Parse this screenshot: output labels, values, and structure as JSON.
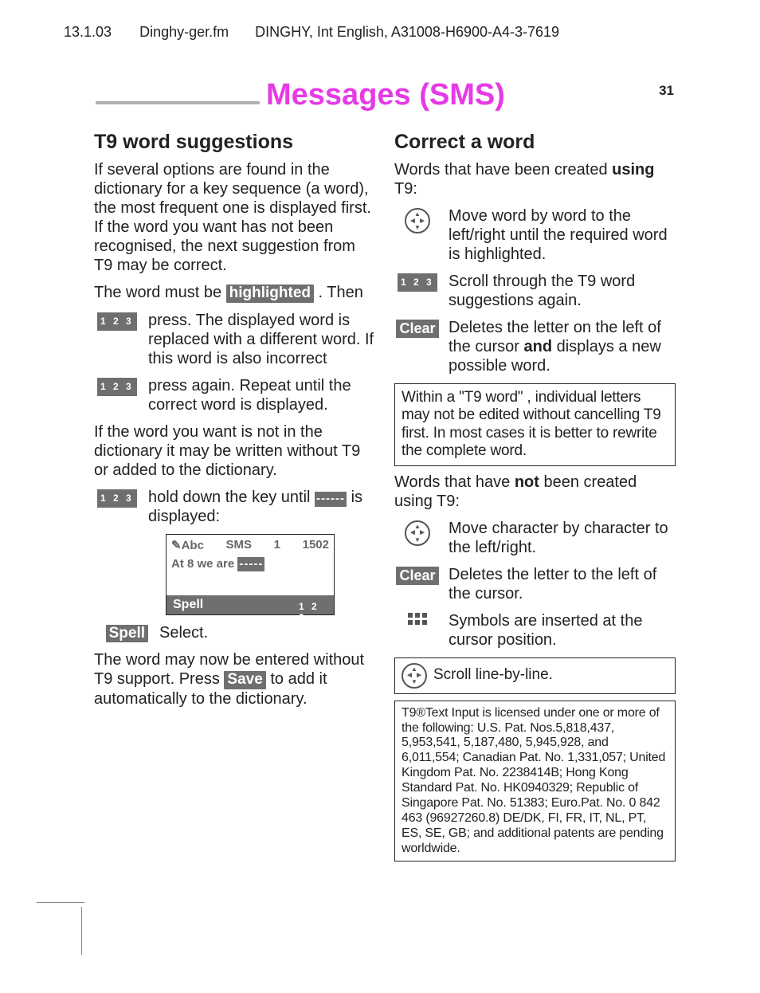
{
  "header": {
    "date": "13.1.03",
    "file": "Dinghy-ger.fm",
    "doc": "DINGHY, Int English, A31008-H6900-A4-3-7619"
  },
  "title": "Messages (SMS)",
  "page_number": "31",
  "left": {
    "heading": "T9 word suggestions",
    "p1": "If several options are found in the dictionary for a key sequence (a word), the most frequent one is displayed first. If the word you want has not been recognised, the next suggestion from T9 may be correct.",
    "p2_pre": "The word must be ",
    "p2_chip": "highlighted",
    "p2_post": " . Then",
    "step1": "press. The displayed word is replaced with a different word. If this word is also incorrect",
    "step2": "press again. Repeat until the correct word is displayed.",
    "p3": "If the word you want is not in the dictionary it may be written without T9 or added to the dictionary.",
    "step3_pre": "hold down the key until ",
    "step3_post": " is displayed:",
    "dash_chip": "------",
    "phone": {
      "mode": "Abc",
      "title": "SMS",
      "count": "1",
      "max": "1502",
      "body_pre": "At 8 we are ",
      "body_chip": "-----",
      "softkey_left": "Spell"
    },
    "spell_label": "Spell",
    "spell_desc": "Select.",
    "p4_pre": "The word may now be entered without T9 support. Press ",
    "p4_chip": "Save",
    "p4_post": " to add it automatically to the dictionary."
  },
  "right": {
    "heading": "Correct a word",
    "p1_pre": "Words that have been created ",
    "p1_bold": "using",
    "p1_post": " T9:",
    "r1": "Move word by word to the left/right until the required word is highlighted.",
    "r2": "Scroll through the T9 word suggestions again.",
    "clear_label": "Clear",
    "r3_pre": "Deletes the letter on the left of the cursor ",
    "r3_bold": "and",
    "r3_post": " displays a new possible word.",
    "box1": "Within a \"T9 word\" , individual letters may not be edited without cancelling T9 first. In most cases it is better to rewrite the complete word.",
    "p2_pre": "Words that have ",
    "p2_bold": "not",
    "p2_post": " been created using T9:",
    "r4": "Move character by character to the left/right.",
    "r5": "Deletes the letter to the left of the cursor.",
    "r6": "Symbols are inserted at the cursor position.",
    "box2": "Scroll line-by-line.",
    "patents": "T9®Text Input is licensed under one or more of the following: U.S. Pat. Nos.5,818,437, 5,953,541, 5,187,480, 5,945,928, and 6,011,554; Canadian Pat. No. 1,331,057; United Kingdom Pat. No. 2238414B; Hong Kong Standard Pat. No. HK0940329; Republic of Singapore Pat. No. 51383; Euro.Pat. No. 0 842 463 (96927260.8) DE/DK, FI, FR, IT, NL, PT, ES, SE, GB; and additional patents are pending worldwide."
  }
}
